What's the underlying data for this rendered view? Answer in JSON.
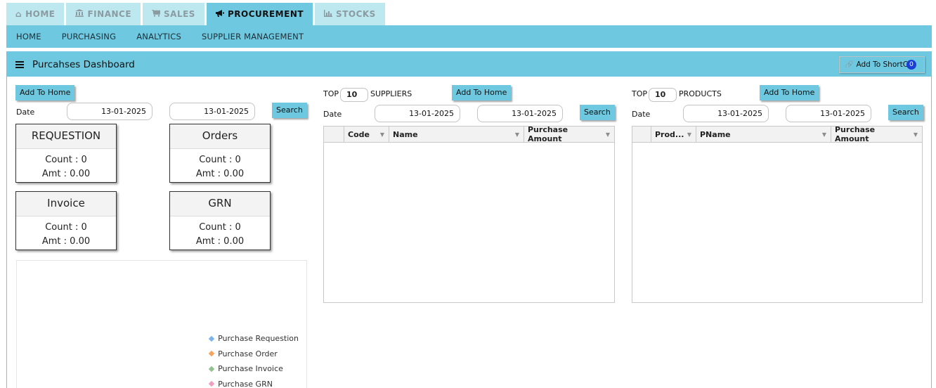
{
  "modules": [
    {
      "label": "HOME",
      "icon": "home-icon",
      "glyph": "⌂",
      "active": false
    },
    {
      "label": "FINANCE",
      "icon": "bank-icon",
      "glyph": "🏛",
      "active": false
    },
    {
      "label": "SALES",
      "icon": "cart-icon",
      "glyph": "🛒",
      "active": false
    },
    {
      "label": "PROCUREMENT",
      "icon": "megaphone-icon",
      "glyph": "📢",
      "active": true
    },
    {
      "label": "STOCKS",
      "icon": "bar-chart-icon",
      "glyph": "📊",
      "active": false
    }
  ],
  "subnav": [
    "HOME",
    "PURCHASING",
    "ANALYTICS",
    "SUPPLIER MANAGEMENT"
  ],
  "panel": {
    "title": "Purcahses Dashboard",
    "shortcut_label": "Add To ShortCut",
    "shortcut_badge": "0"
  },
  "left": {
    "add_home_label": "Add To Home",
    "date_label": "Date",
    "date_from": "13-01-2025",
    "date_to": "13-01-2025",
    "search_label": "Search",
    "cards": [
      {
        "title": "REQUESTION",
        "count": "Count : 0",
        "amt": "Amt : 0.00"
      },
      {
        "title": "Orders",
        "count": "Count : 0",
        "amt": "Amt : 0.00"
      },
      {
        "title": "Invoice",
        "count": "Count : 0",
        "amt": "Amt : 0.00"
      },
      {
        "title": "GRN",
        "count": "Count : 0",
        "amt": "Amt : 0.00"
      }
    ],
    "legend": [
      {
        "label": "Purchase Requestion",
        "color": "#7cb5ec"
      },
      {
        "label": "Purchase Order",
        "color": "#f7a35c"
      },
      {
        "label": "Purchase Invoice",
        "color": "#90c38f"
      },
      {
        "label": "Purchase GRN",
        "color": "#f19fc0"
      }
    ]
  },
  "suppliers": {
    "top_label": "TOP",
    "top_value": "10",
    "suffix": "SUPPLIERS",
    "add_home_label": "Add To Home",
    "date_label": "Date",
    "date_from": "13-01-2025",
    "date_to": "13-01-2025",
    "search_label": "Search",
    "columns": [
      "Code",
      "Name",
      "Purchase Amount"
    ]
  },
  "products": {
    "top_label": "TOP",
    "top_value": "10",
    "suffix": "PRODUCTS",
    "add_home_label": "Add To Home",
    "date_label": "Date",
    "date_from": "13-01-2025",
    "date_to": "13-01-2025",
    "search_label": "Search",
    "columns": [
      "Prod...",
      "PName",
      "Purchase Amount"
    ]
  }
}
